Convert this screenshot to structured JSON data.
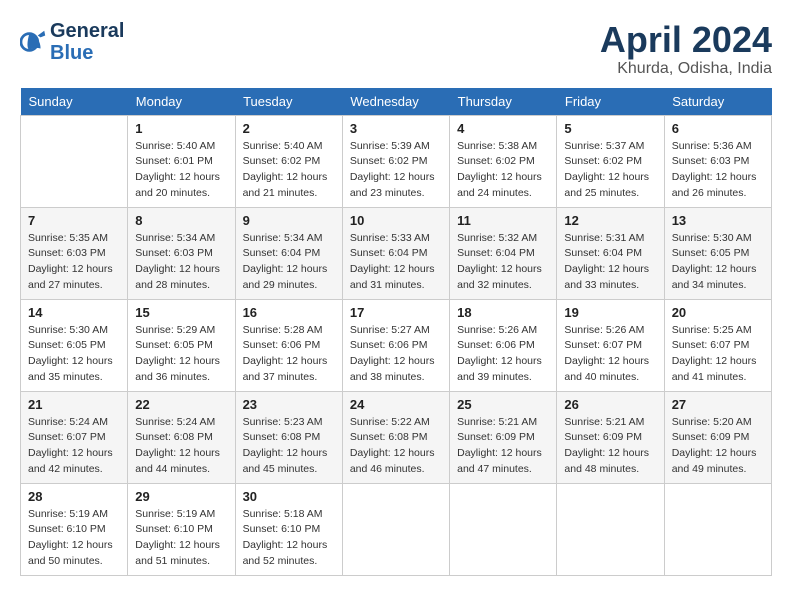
{
  "header": {
    "logo_line1": "General",
    "logo_line2": "Blue",
    "month": "April 2024",
    "location": "Khurda, Odisha, India"
  },
  "weekdays": [
    "Sunday",
    "Monday",
    "Tuesday",
    "Wednesday",
    "Thursday",
    "Friday",
    "Saturday"
  ],
  "weeks": [
    [
      {
        "day": "",
        "sunrise": "",
        "sunset": "",
        "daylight": ""
      },
      {
        "day": "1",
        "sunrise": "5:40 AM",
        "sunset": "6:01 PM",
        "daylight": "12 hours and 20 minutes."
      },
      {
        "day": "2",
        "sunrise": "5:40 AM",
        "sunset": "6:02 PM",
        "daylight": "12 hours and 21 minutes."
      },
      {
        "day": "3",
        "sunrise": "5:39 AM",
        "sunset": "6:02 PM",
        "daylight": "12 hours and 23 minutes."
      },
      {
        "day": "4",
        "sunrise": "5:38 AM",
        "sunset": "6:02 PM",
        "daylight": "12 hours and 24 minutes."
      },
      {
        "day": "5",
        "sunrise": "5:37 AM",
        "sunset": "6:02 PM",
        "daylight": "12 hours and 25 minutes."
      },
      {
        "day": "6",
        "sunrise": "5:36 AM",
        "sunset": "6:03 PM",
        "daylight": "12 hours and 26 minutes."
      }
    ],
    [
      {
        "day": "7",
        "sunrise": "5:35 AM",
        "sunset": "6:03 PM",
        "daylight": "12 hours and 27 minutes."
      },
      {
        "day": "8",
        "sunrise": "5:34 AM",
        "sunset": "6:03 PM",
        "daylight": "12 hours and 28 minutes."
      },
      {
        "day": "9",
        "sunrise": "5:34 AM",
        "sunset": "6:04 PM",
        "daylight": "12 hours and 29 minutes."
      },
      {
        "day": "10",
        "sunrise": "5:33 AM",
        "sunset": "6:04 PM",
        "daylight": "12 hours and 31 minutes."
      },
      {
        "day": "11",
        "sunrise": "5:32 AM",
        "sunset": "6:04 PM",
        "daylight": "12 hours and 32 minutes."
      },
      {
        "day": "12",
        "sunrise": "5:31 AM",
        "sunset": "6:04 PM",
        "daylight": "12 hours and 33 minutes."
      },
      {
        "day": "13",
        "sunrise": "5:30 AM",
        "sunset": "6:05 PM",
        "daylight": "12 hours and 34 minutes."
      }
    ],
    [
      {
        "day": "14",
        "sunrise": "5:30 AM",
        "sunset": "6:05 PM",
        "daylight": "12 hours and 35 minutes."
      },
      {
        "day": "15",
        "sunrise": "5:29 AM",
        "sunset": "6:05 PM",
        "daylight": "12 hours and 36 minutes."
      },
      {
        "day": "16",
        "sunrise": "5:28 AM",
        "sunset": "6:06 PM",
        "daylight": "12 hours and 37 minutes."
      },
      {
        "day": "17",
        "sunrise": "5:27 AM",
        "sunset": "6:06 PM",
        "daylight": "12 hours and 38 minutes."
      },
      {
        "day": "18",
        "sunrise": "5:26 AM",
        "sunset": "6:06 PM",
        "daylight": "12 hours and 39 minutes."
      },
      {
        "day": "19",
        "sunrise": "5:26 AM",
        "sunset": "6:07 PM",
        "daylight": "12 hours and 40 minutes."
      },
      {
        "day": "20",
        "sunrise": "5:25 AM",
        "sunset": "6:07 PM",
        "daylight": "12 hours and 41 minutes."
      }
    ],
    [
      {
        "day": "21",
        "sunrise": "5:24 AM",
        "sunset": "6:07 PM",
        "daylight": "12 hours and 42 minutes."
      },
      {
        "day": "22",
        "sunrise": "5:24 AM",
        "sunset": "6:08 PM",
        "daylight": "12 hours and 44 minutes."
      },
      {
        "day": "23",
        "sunrise": "5:23 AM",
        "sunset": "6:08 PM",
        "daylight": "12 hours and 45 minutes."
      },
      {
        "day": "24",
        "sunrise": "5:22 AM",
        "sunset": "6:08 PM",
        "daylight": "12 hours and 46 minutes."
      },
      {
        "day": "25",
        "sunrise": "5:21 AM",
        "sunset": "6:09 PM",
        "daylight": "12 hours and 47 minutes."
      },
      {
        "day": "26",
        "sunrise": "5:21 AM",
        "sunset": "6:09 PM",
        "daylight": "12 hours and 48 minutes."
      },
      {
        "day": "27",
        "sunrise": "5:20 AM",
        "sunset": "6:09 PM",
        "daylight": "12 hours and 49 minutes."
      }
    ],
    [
      {
        "day": "28",
        "sunrise": "5:19 AM",
        "sunset": "6:10 PM",
        "daylight": "12 hours and 50 minutes."
      },
      {
        "day": "29",
        "sunrise": "5:19 AM",
        "sunset": "6:10 PM",
        "daylight": "12 hours and 51 minutes."
      },
      {
        "day": "30",
        "sunrise": "5:18 AM",
        "sunset": "6:10 PM",
        "daylight": "12 hours and 52 minutes."
      },
      {
        "day": "",
        "sunrise": "",
        "sunset": "",
        "daylight": ""
      },
      {
        "day": "",
        "sunrise": "",
        "sunset": "",
        "daylight": ""
      },
      {
        "day": "",
        "sunrise": "",
        "sunset": "",
        "daylight": ""
      },
      {
        "day": "",
        "sunrise": "",
        "sunset": "",
        "daylight": ""
      }
    ]
  ],
  "labels": {
    "sunrise_prefix": "Sunrise: ",
    "sunset_prefix": "Sunset: ",
    "daylight_prefix": "Daylight: "
  }
}
